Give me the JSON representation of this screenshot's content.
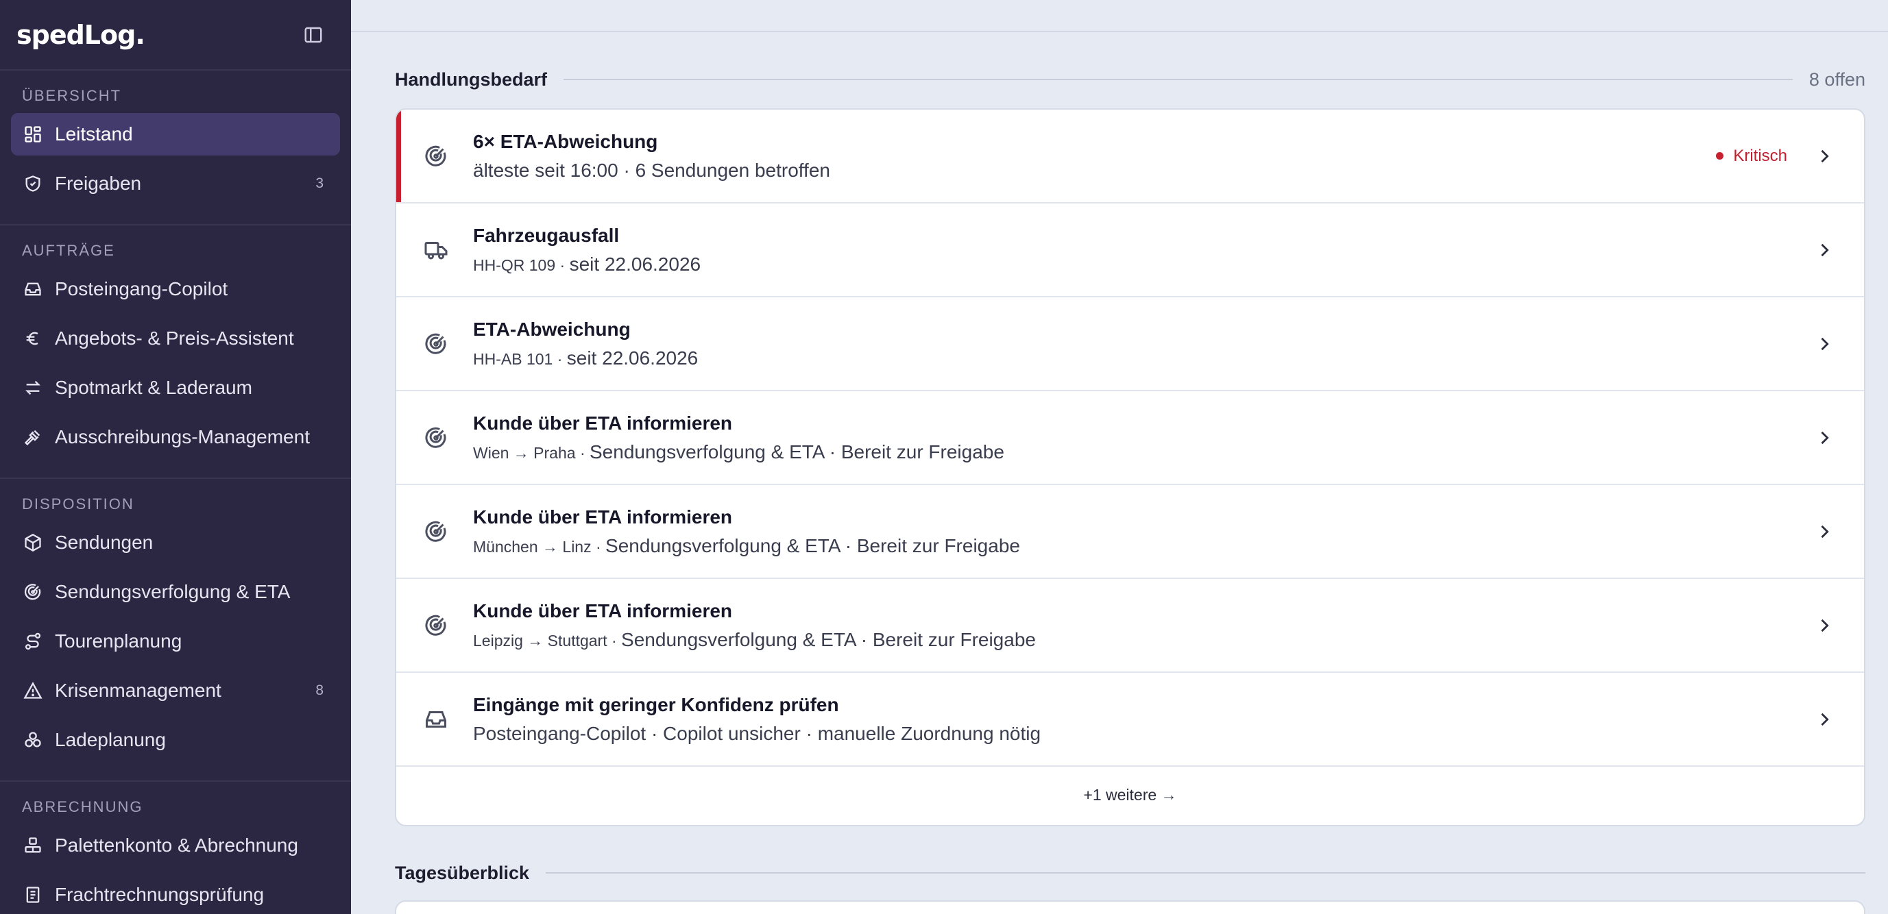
{
  "app": {
    "logo": "spedLog."
  },
  "sidebar": {
    "sections": [
      {
        "title": "ÜBERSICHT",
        "items": [
          {
            "label": "Leitstand",
            "icon": "dashboard-icon",
            "active": true,
            "count": ""
          },
          {
            "label": "Freigaben",
            "icon": "shield-check-icon",
            "active": false,
            "count": "3"
          }
        ]
      },
      {
        "title": "AUFTRÄGE",
        "items": [
          {
            "label": "Posteingang-Copilot",
            "icon": "inbox-icon",
            "count": ""
          },
          {
            "label": "Angebots- & Preis-Assistent",
            "icon": "euro-icon",
            "count": ""
          },
          {
            "label": "Spotmarkt & Laderaum",
            "icon": "swap-arrows-icon",
            "count": ""
          },
          {
            "label": "Ausschreibungs-Management",
            "icon": "gavel-icon",
            "count": ""
          }
        ]
      },
      {
        "title": "DISPOSITION",
        "items": [
          {
            "label": "Sendungen",
            "icon": "package-icon",
            "count": ""
          },
          {
            "label": "Sendungsverfolgung & ETA",
            "icon": "radar-icon",
            "count": ""
          },
          {
            "label": "Tourenplanung",
            "icon": "route-icon",
            "count": ""
          },
          {
            "label": "Krisenmanagement",
            "icon": "warning-triangle-icon",
            "count": "8"
          },
          {
            "label": "Ladeplanung",
            "icon": "boxes-icon",
            "count": ""
          }
        ]
      },
      {
        "title": "ABRECHNUNG",
        "items": [
          {
            "label": "Palettenkonto & Abrechnung",
            "icon": "pallet-icon",
            "count": ""
          },
          {
            "label": "Frachtrechnungsprüfung",
            "icon": "invoice-icon",
            "count": ""
          }
        ]
      }
    ]
  },
  "main": {
    "action_section": {
      "title": "Handlungsbedarf",
      "meta": "8 offen"
    },
    "rows": [
      {
        "title": "6× ETA-Abweichung",
        "sub_small": "",
        "sub": "älteste seit 16:00 · 6 Sendungen betroffen",
        "icon": "radar-icon",
        "badge": "Kritisch",
        "critical": true
      },
      {
        "title": "Fahrzeugausfall",
        "sub_small": "HH-QR 109 · ",
        "sub": "seit 22.06.2026",
        "icon": "truck-icon",
        "badge": "",
        "critical": false
      },
      {
        "title": "ETA-Abweichung",
        "sub_small": "HH-AB 101 · ",
        "sub": "seit 22.06.2026",
        "icon": "radar-icon",
        "badge": "",
        "critical": false
      },
      {
        "title": "Kunde über ETA informieren",
        "sub_small": "Wien → Praha · ",
        "sub": "Sendungsverfolgung & ETA · Bereit zur Freigabe",
        "icon": "radar-icon",
        "badge": "",
        "critical": false
      },
      {
        "title": "Kunde über ETA informieren",
        "sub_small": "München → Linz · ",
        "sub": "Sendungsverfolgung & ETA · Bereit zur Freigabe",
        "icon": "radar-icon",
        "badge": "",
        "critical": false
      },
      {
        "title": "Kunde über ETA informieren",
        "sub_small": "Leipzig → Stuttgart · ",
        "sub": "Sendungsverfolgung & ETA · Bereit zur Freigabe",
        "icon": "radar-icon",
        "badge": "",
        "critical": false
      },
      {
        "title": "Eingänge mit geringer Konfidenz prüfen",
        "sub_small": "",
        "sub": "Posteingang-Copilot · Copilot unsicher · manuelle Zuordnung nötig",
        "icon": "inbox-icon",
        "badge": "",
        "critical": false
      }
    ],
    "more_label": "+1 weitere →",
    "day_section": {
      "title": "Tagesüberblick"
    }
  },
  "colors": {
    "sidebar_bg": "#2b2641",
    "active_bg": "#433b6c",
    "critical": "#c8202f",
    "page_bg": "#e5eaf3"
  }
}
